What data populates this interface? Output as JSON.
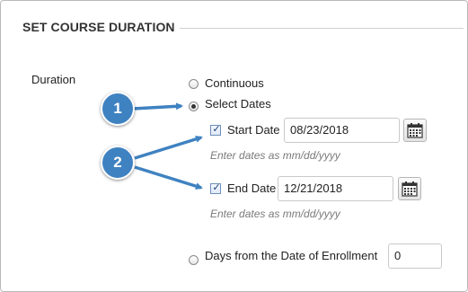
{
  "section": {
    "title": "SET COURSE DURATION"
  },
  "duration": {
    "label": "Duration",
    "options": {
      "continuous": "Continuous",
      "select_dates": "Select Dates",
      "days_from_enrollment": "Days from the Date of Enrollment"
    },
    "selected": "select_dates"
  },
  "start_date": {
    "label": "Start Date",
    "checked": true,
    "value": "08/23/2018",
    "hint": "Enter dates as mm/dd/yyyy"
  },
  "end_date": {
    "label": "End Date",
    "checked": true,
    "value": "12/21/2018",
    "hint": "Enter dates as mm/dd/yyyy"
  },
  "days_input": {
    "value": "0"
  },
  "callouts": [
    "1",
    "2"
  ],
  "colors": {
    "callout": "#3f82c1",
    "arrow": "#3f82c1"
  }
}
